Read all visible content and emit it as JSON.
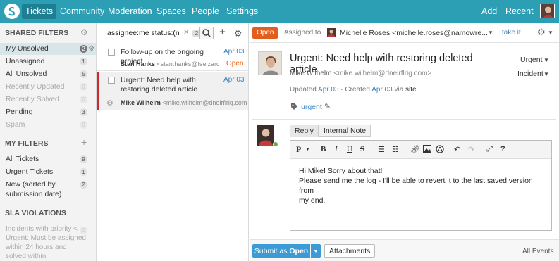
{
  "nav": {
    "items": [
      "Tickets",
      "Community",
      "Moderation",
      "Spaces",
      "People",
      "Settings"
    ],
    "right": [
      "Add",
      "Recent"
    ],
    "colors": {
      "bar": "#2c9fb4",
      "active": "#1f7f92"
    }
  },
  "sidebar": {
    "shared_filters_title": "SHARED FILTERS",
    "shared": [
      {
        "label": "My Unsolved",
        "count": "2"
      },
      {
        "label": "Unassigned",
        "count": "1"
      },
      {
        "label": "All Unsolved",
        "count": "5"
      },
      {
        "label": "Recently Updated",
        "count": "0"
      },
      {
        "label": "Recently Solved",
        "count": "0"
      },
      {
        "label": "Pending",
        "count": "3"
      },
      {
        "label": "Spam",
        "count": "0"
      }
    ],
    "my_filters_title": "MY FILTERS",
    "mine": [
      {
        "label": "All Tickets",
        "count": "9"
      },
      {
        "label": "Urgent Tickets",
        "count": "1"
      },
      {
        "label": "New (sorted by",
        "label2": "submission date)",
        "count": "2"
      }
    ],
    "sla_title": "SLA VIOLATIONS",
    "sla_text": "Incidents with priority < Urgent: Must be assigned within 24 hours and solved within",
    "sla_count": "0"
  },
  "list": {
    "search": {
      "value": "assignee:me status:(n",
      "count": "2"
    },
    "rows": [
      {
        "title": "Follow-up on the ongoing project",
        "date": "Apr 03",
        "requester": "Stan Hanks",
        "email": "<stan.hanks@tseizarcg...",
        "status": "Open"
      },
      {
        "title": "Urgent: Need help with restoring deleted article",
        "date": "Apr 03",
        "requester": "Mike Wilhelm",
        "email": "<mike.wilhelm@dneirflrig.com>",
        "status": ""
      }
    ]
  },
  "ticket": {
    "status": "Open",
    "assigned_label": "Assigned to",
    "assignee": "Michelle Roses <michelle.roses@namowre...",
    "take_it": "take it",
    "subject": "Urgent: Need help with restoring deleted article",
    "priority": "Urgent",
    "type": "Incident",
    "requester_name": "Mike Wilhelm",
    "requester_email": "<mike.wilhelm@dneirflrig.com>",
    "meta": {
      "updated_label": "Updated",
      "updated": "Apr 03",
      "created_label": "· Created",
      "created": "Apr 03",
      "via": "via",
      "channel": "site"
    },
    "tag": "urgent",
    "tabs": [
      "Reply",
      "Internal Note"
    ],
    "reply_lines": [
      "Hi Mike! Sorry about that!",
      "Please send me the log - I'll be able to revert it to the last saved version from",
      "my end."
    ],
    "submit": {
      "prefix": "Submit as",
      "status": "Open"
    },
    "attachments": "Attachments",
    "all_events": "All Events",
    "colors": {
      "open": "#e35d1c",
      "submit": "#3b9bd6",
      "link": "#3a86c3"
    }
  }
}
